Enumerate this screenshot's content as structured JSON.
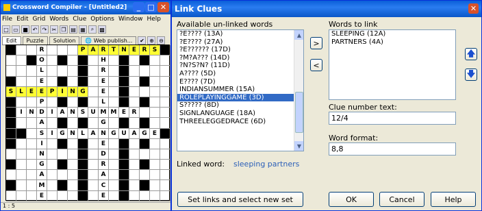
{
  "left_window": {
    "title": "Crossword Compiler - [Untitled2]",
    "menu": [
      "File",
      "Edit",
      "Grid",
      "Words",
      "Clue",
      "Options",
      "Window",
      "Help"
    ],
    "tabs": [
      "Edit",
      "Puzzle",
      "Solution"
    ],
    "web_publish": "Web publish...",
    "status": "1 : 5"
  },
  "grid_rows": [
    "#..R...PARTNERS#",
    "..#O.#.#.H.#.#..",
    "...L...#.R.#....",
    "#..E.#.#.E.#.#..",
    "SLEEPING.E.#....",
    "#..P.#.#.L.#.#..",
    "#INDIANSUMMER...",
    "#..A.#.#.G.#.#..",
    "##.SIGNLANGUAGE#",
    "#..I.#.#.E.#.#..",
    "...N...#.D.#....",
    "#..G.#.#.R.#.#..",
    "...A...#.A.#....",
    "#..M.#.#.C.#.#..",
    "...E...#.E.#...."
  ],
  "dialog": {
    "title": "Link Clues",
    "available_label": "Available un-linked words",
    "available_items": [
      "?E???? (13A)",
      "?E???? (27A)",
      "?E?????? (17D)",
      "?M?A??? (14D)",
      "?N?S?N? (11D)",
      "A???? (5D)",
      "E???? (7D)",
      "INDIANSUMMER (15A)",
      "ROLEPLAYINGGAME (3D)",
      "S????? (8D)",
      "SIGNLANGUAGE (18A)",
      "THREELEGGEDRACE (6D)"
    ],
    "selected_index": 8,
    "words_label": "Words to link",
    "words_items": [
      "SLEEPING (12A)",
      "PARTNERS (4A)"
    ],
    "linked_label": "Linked word:",
    "linked_value": "sleeping partners",
    "clue_number_label": "Clue number text:",
    "clue_number_value": "12/4",
    "word_format_label": "Word format:",
    "word_format_value": "8,8",
    "btn_set": "Set links and select new set",
    "btn_ok": "OK",
    "btn_cancel": "Cancel",
    "btn_help": "Help",
    "btn_add": ">",
    "btn_remove": "<",
    "close": "✕"
  }
}
